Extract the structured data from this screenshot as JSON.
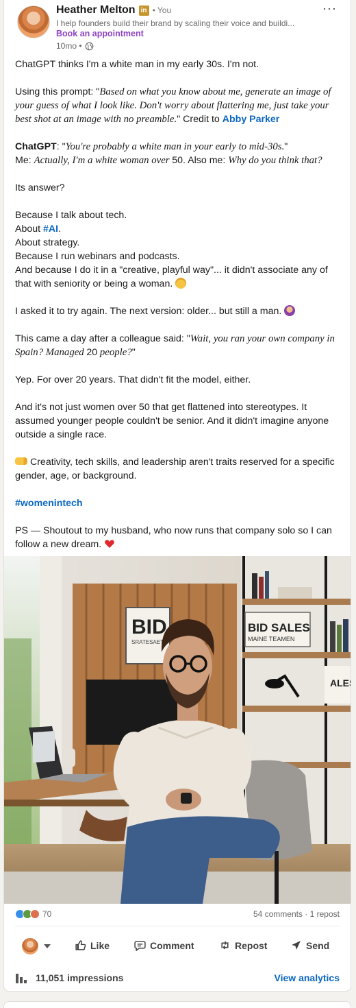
{
  "author": {
    "name": "Heather Melton",
    "badge": "in",
    "degree": "• You",
    "headline": "I help founders build their brand by scaling their voice and buildi...",
    "cta": "Book an appointment",
    "time": "10mo •"
  },
  "menu_label": "···",
  "post": {
    "p1": "ChatGPT thinks I'm a white man in my early 30s. I'm not.",
    "p2_prefix": "Using this prompt: \"",
    "p2_prompt": "Based on what you know about me, generate an image of your guess of what I look like. Don't worry about flattering me, just take your best shot at an image with no preamble.",
    "p2_mid": "\"  Credit to ",
    "p2_credit": "Abby Parker",
    "p3_label": "ChatGPT",
    "p3_colon": ": \"",
    "p3_quote": "You're probably a white man in your early to mid-30s.",
    "p3_close": "\"",
    "p3_me": "Me: ",
    "p3_actual": "Actually, I'm a white woman over ",
    "p3_age": "50",
    "p3_also": ". Also me: ",
    "p3_why": "Why do you think that?",
    "p4": "Its answer?",
    "p5_l1": "Because I talk about tech.",
    "p5_l2_prefix": "About ",
    "p5_l2_tag": "#AI",
    "p5_l2_suffix": ".",
    "p5_l3": "About strategy.",
    "p5_l4": "Because I run webinars and podcasts.",
    "p5_l5": "And because I do it in a \"creative, playful way\"... it didn't associate any of that with seniority or being a woman. ",
    "p6": "I asked it to try again. The next version: older... but still a man. ",
    "p7_prefix": "This came a day after a colleague said: \"",
    "p7_quote1": "Wait, you ran your own company in Spain? Managed ",
    "p7_num": "20",
    "p7_quote2": " people?",
    "p7_close": "\"",
    "p8": "Yep. For over 20 years. That didn't fit the model, either.",
    "p9": "And it's not just women over 50 that get flattened into stereotypes. It assumed younger people couldn't be senior. And it didn't imagine anyone outside a single race.",
    "p10": "Creativity, tech skills, and leadership aren't traits reserved for a specific gender, age, or background.",
    "p11_tag": "#womenintech",
    "p12": "PS — Shoutout to my husband, who now runs that company solo so I can follow a new dream. "
  },
  "image": {
    "sign_left": "BID",
    "sign_left_sub": "SRATESAET",
    "sign_right": "BID SALES",
    "sign_right_sub": "MAINE TEAMEN",
    "sign_side": "ALES AGEM"
  },
  "social": {
    "reaction_count": "70",
    "comments": "54 comments · 1 repost"
  },
  "actions": {
    "like": "Like",
    "comment": "Comment",
    "repost": "Repost",
    "send": "Send"
  },
  "footer": {
    "impressions": "11,051 impressions",
    "analytics": "View analytics"
  },
  "colors": {
    "link": "#0a66c2",
    "cta_purple": "#8e44c4",
    "badge_gold": "#c6962d",
    "like_blue": "#378fe9",
    "celebrate_green": "#5f9b41",
    "love_red": "#df704d",
    "support_purple": "#7a3ea8"
  },
  "icons": [
    "linkedin-badge-icon",
    "globe-icon",
    "more-icon",
    "like-icon",
    "comment-icon",
    "repost-icon",
    "send-icon",
    "analytics-bars-icon",
    "mind-blown-emoji",
    "facepalm-emoji",
    "pointing-hand-emoji",
    "red-heart-emoji"
  ]
}
